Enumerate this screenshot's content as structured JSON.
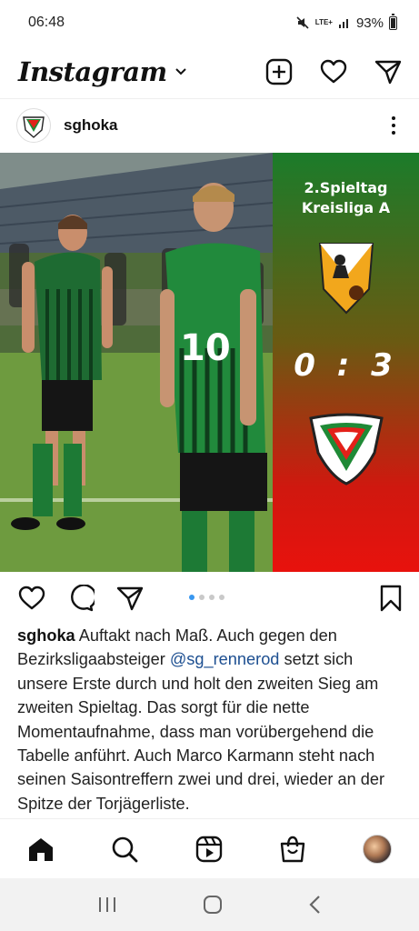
{
  "status_bar": {
    "time": "06:48",
    "network": "LTE+",
    "battery": "93%"
  },
  "header": {
    "logo": "Instagram"
  },
  "post": {
    "username": "sghoka",
    "image": {
      "matchday_line1": "2.Spieltag",
      "matchday_line2": "Kreisliga A",
      "score": "0 : 3",
      "jersey_number": "10",
      "carousel_count": 4,
      "carousel_active": 0
    },
    "caption": {
      "username": "sghoka",
      "text_before": "Auftakt nach Maß. Auch gegen den Bezirksligaabsteiger",
      "mention": "@sg_rennerod",
      "text_after": "setzt sich unsere Erste durch und holt den zweiten Sieg am zweiten Spieltag. Das sorgt für die nette Momentaufnahme, dass man vorübergehend die Tabelle anführt. Auch Marco Karmann steht nach seinen Saisontreffern zwei und drei, wieder an der Spitze der Torjägerliste."
    }
  },
  "colors": {
    "panel_top": "#1b7c2a",
    "panel_bottom": "#e8120d",
    "mention": "#1d4f91",
    "carousel_active": "#3897f0"
  },
  "icons": {
    "header": [
      "chevron-down-icon",
      "new-post-icon",
      "heart-icon",
      "direct-message-icon"
    ],
    "actions": [
      "like-icon",
      "comment-icon",
      "share-icon",
      "bookmark-icon"
    ],
    "nav": [
      "home-icon",
      "search-icon",
      "reels-icon",
      "shop-icon",
      "profile-avatar"
    ],
    "system": [
      "recents-icon",
      "home-circle-icon",
      "back-icon"
    ]
  }
}
